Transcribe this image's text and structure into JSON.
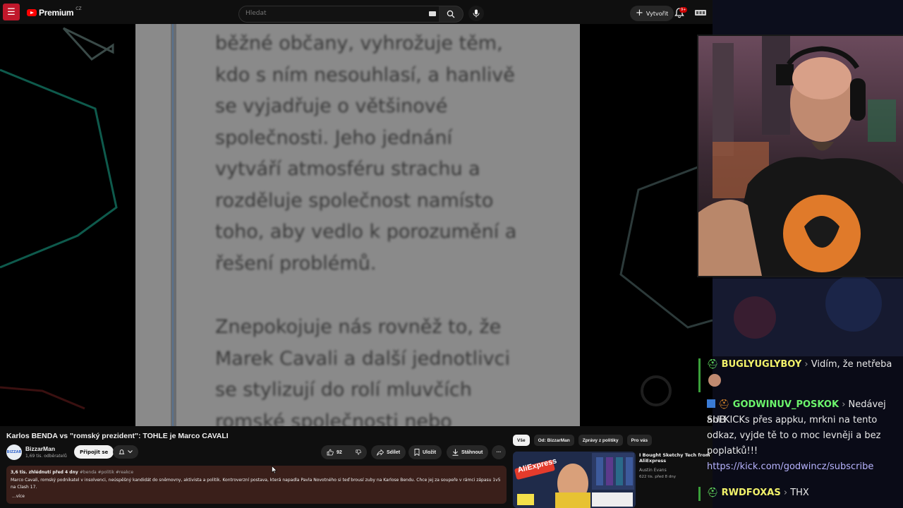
{
  "youtube": {
    "logo_text": "Premium",
    "country": "CZ",
    "search_placeholder": "Hledat",
    "create_label": "Vytvořit",
    "notif_badge": "9+",
    "video_text_paragraph1": [
      "běžné občany, vyhrožuje těm,",
      "kdo s ním nesouhlasí, a hanlivě",
      "se vyjadřuje o většinové",
      "společnosti. Jeho jednání",
      "vytváří atmosféru strachu a",
      "rozděluje společnost namísto",
      "toho, aby vedlo k porozumění a",
      "řešení problémů."
    ],
    "video_text_paragraph2": [
      "Znepokojuje nás rovněž to, že",
      "Marek Cavali a další jednotlivci",
      "se stylizují do rolí mluvčích",
      "romské společnosti nebo"
    ],
    "video_title": "Karlos BENDA vs \"romský prezident\": TOHLE je Marco CAVALI",
    "channel": {
      "name": "BizzarMan",
      "subs": "1,69 tis. odběratelů",
      "avatar_text": "BIZZAR"
    },
    "join_label": "Připojit se",
    "likes": "92",
    "share_label": "Sdílet",
    "save_label": "Uložit",
    "download_label": "Stáhnout",
    "more_label": "···",
    "description": {
      "views_date": "3,6 tis. zhlédnutí  před 4 dny",
      "tags": "#benda #politik #reakce",
      "text": "Marco Cavali, romský podnikatel v insolvenci, neúspěšný kandidát do sněmovny, aktivista a politik. Kontroverzní postava, která napadla Pavla Novotného si teď brousí zuby na Karlose Bendu. Chce jej za soupeře v rámci zápasu 1v5 na Clash 17.",
      "more": "...více"
    },
    "chips": [
      "Vše",
      "Od: BizzarMan",
      "Zprávy z politiky",
      "Pro vás"
    ],
    "recommended": {
      "title_line1": "I Bought Sketchy Tech from",
      "title_line2": "AliExpress",
      "thumb_text": "AliExpress",
      "channel": "Austin Evans",
      "stats": "622 tis.   před 8 dny"
    }
  },
  "chat": [
    {
      "nick": "BUGLYUGLYBOY",
      "nick_color": "#f2f26a",
      "message": "Vidím, že netřeba"
    },
    {
      "nick": "GODWINUV_POSKOK",
      "nick_color": "#6cf56c",
      "message_lines": [
        "Nedávej SUB",
        "ani KICKs přes appku, mrkni na tento",
        "odkaz, vyjde tě to o moc levněji a bez",
        "poplatků!!!"
      ],
      "link": "https://kick.com/godwincz/subscribe"
    },
    {
      "nick": "RWDFOXAS",
      "nick_color": "#f2f26a",
      "message": "THX"
    }
  ],
  "colors": {
    "accent_red": "#ff0000",
    "join_bg": "#f1f1f1",
    "description_bg": "#3a1f1a",
    "chat_bar": "#3aa03a"
  }
}
